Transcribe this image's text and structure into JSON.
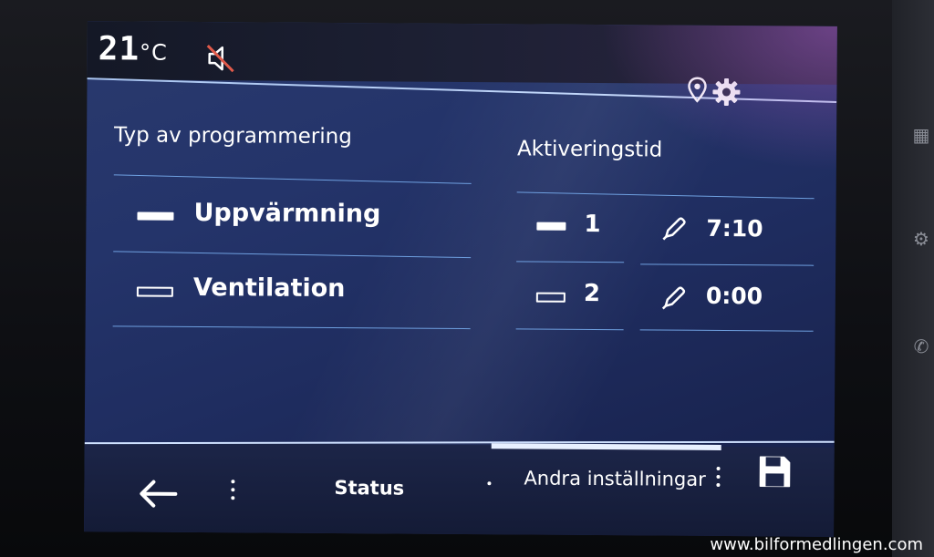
{
  "status": {
    "temperature": "21",
    "temperature_unit": "°C"
  },
  "left_panel": {
    "header": "Typ av programmering",
    "rows": [
      {
        "label": "Uppvärmning",
        "swatch": "filled"
      },
      {
        "label": "Ventilation",
        "swatch": "outline"
      }
    ]
  },
  "right_panel": {
    "header": "Aktiveringstid",
    "rows": [
      {
        "index": "1",
        "swatch": "filled",
        "time": "7:10"
      },
      {
        "index": "2",
        "swatch": "outline",
        "time": "0:00"
      }
    ]
  },
  "bottom": {
    "tabs": [
      {
        "label": "Status"
      },
      {
        "label": "Andra inställningar",
        "active": true
      }
    ]
  },
  "watermark": "www.bilformedlingen.com",
  "icons": {
    "mute": "speaker-muted-icon",
    "location": "location-pin-icon",
    "settings": "gear-icon",
    "edit": "pencil-icon",
    "back": "back-arrow-icon",
    "more": "more-vertical-icon",
    "save": "floppy-disk-icon"
  },
  "colors": {
    "screen_bg": "#22306a",
    "accent_line": "#6fa0e0",
    "text": "#ffffff"
  }
}
